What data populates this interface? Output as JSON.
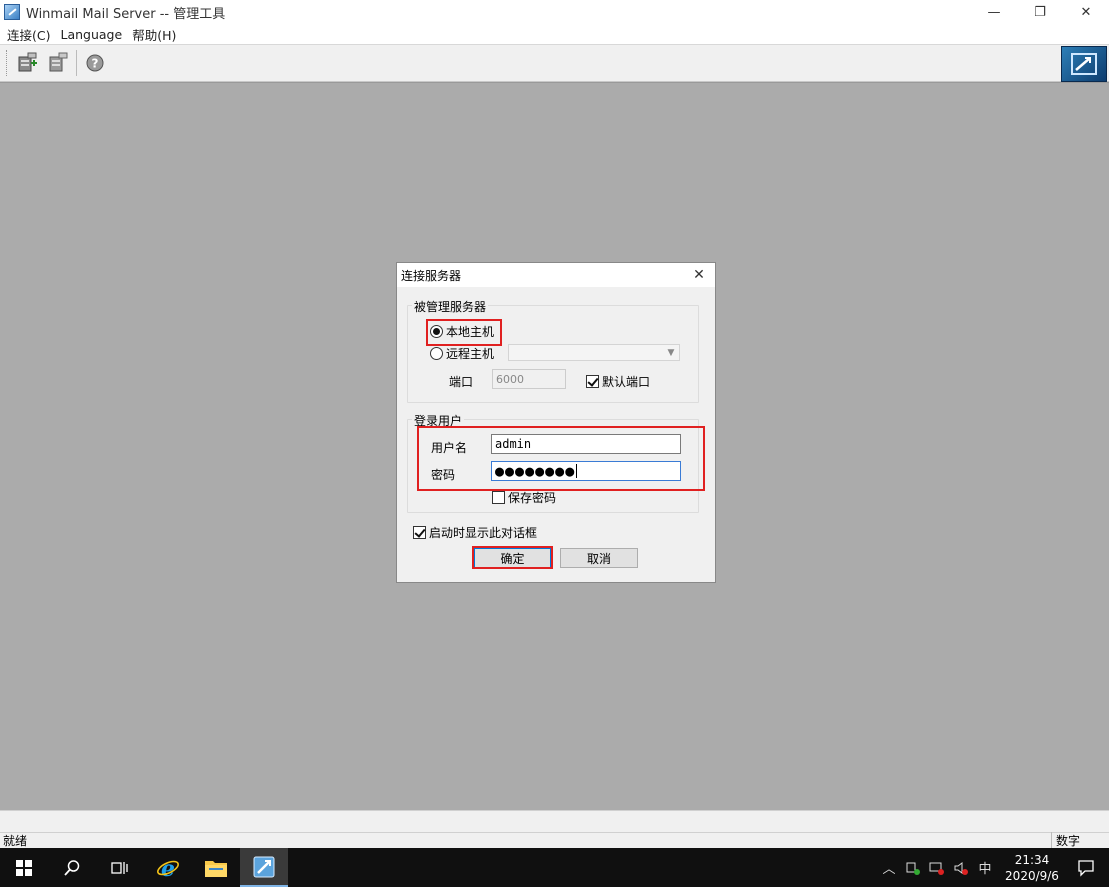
{
  "window": {
    "title": "Winmail Mail Server -- 管理工具",
    "minimize": "—",
    "restore": "❐",
    "close": "✕"
  },
  "menu": {
    "items": [
      "连接(C)",
      "Language",
      "帮助(H)"
    ]
  },
  "toolbar": {
    "buttons": [
      "connect-icon",
      "disconnect-icon",
      "help-icon"
    ]
  },
  "dialog": {
    "title": "连接服务器",
    "close": "✕",
    "server_group": {
      "title": "被管理服务器",
      "local_host": "本地主机",
      "remote_host": "远程主机",
      "remote_value": "",
      "port_label": "端口",
      "port_value": "6000",
      "default_port": "默认端口"
    },
    "login_group": {
      "title": "登录用户",
      "username_label": "用户名",
      "username_value": "admin",
      "password_label": "密码",
      "password_value": "●●●●●●●●",
      "save_password": "保存密码"
    },
    "show_on_startup": "启动时显示此对话框",
    "ok": "确定",
    "cancel": "取消"
  },
  "statusbar": {
    "left": "就绪",
    "right": "数字"
  },
  "taskbar": {
    "clock_time": "21:34",
    "clock_date": "2020/9/6",
    "ime": "中"
  }
}
